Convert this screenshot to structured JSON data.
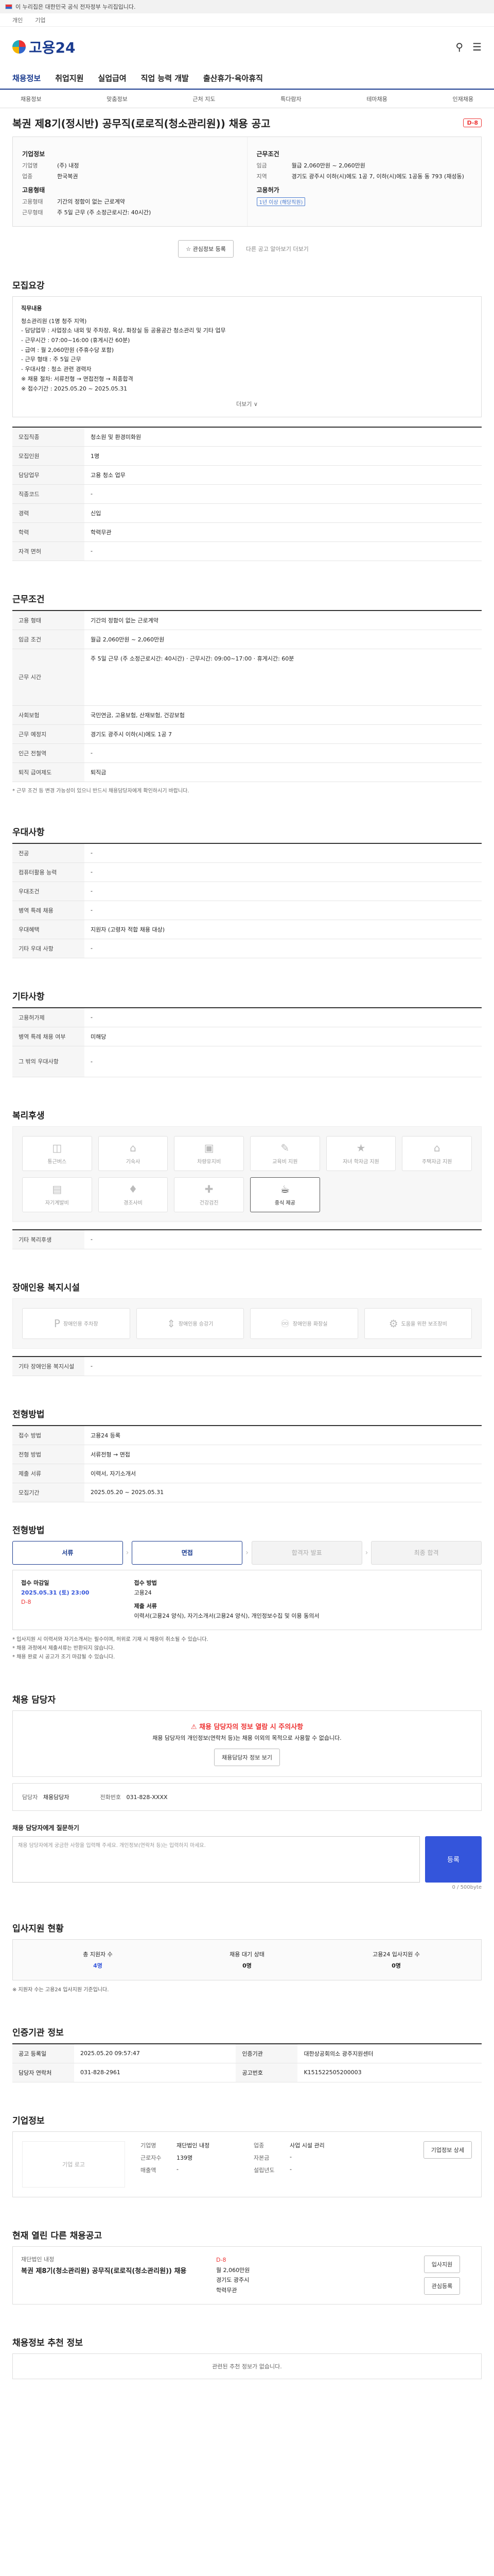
{
  "gov_banner": "이 누리집은 대한민국 공식 전자정부 누리집입니다.",
  "lang_bar": [
    "개인",
    "기업"
  ],
  "header": {
    "logo_text": "고용24",
    "search_icon": "search-icon",
    "menu_icon": "menu-icon"
  },
  "nav": {
    "items": [
      "채용정보",
      "취업지원",
      "실업급여",
      "직업 능력 개발",
      "출산휴가·육아휴직"
    ]
  },
  "subnav": {
    "items": [
      "채용정보",
      "맞춤정보",
      "근처 지도",
      "특다람자",
      "테마채용",
      "인재채용"
    ]
  },
  "job": {
    "title": "복권 제8기(정시반) 공무직(로로직(청소관리원)) 채용 공고",
    "dday": "D-8",
    "company_label": "기업정보",
    "company": "(주) 내정",
    "company_sub": "한국복권",
    "conditions_label": "근무조건",
    "pay_label": "임금",
    "pay": "월급 2,060만원 ~ 2,060만원",
    "place_label": "지역",
    "place": "경기도 광주시 이하(시)에도 1공 7, 이하(시)에도 1공동 동 793 (재성동)",
    "employment_label": "고용형태",
    "employment": "기간의 정함이 없는 근로계약",
    "work_type_label": "근무형태",
    "work_type": "주 5일 근무 (주 소정근로시간: 40시간)",
    "edu_label": "학력",
    "edu": "학력무관",
    "career_label": "경력",
    "career": "신입",
    "etc_label": "우대사항",
    "etc_tag": "고령자 적합",
    "req_label": "고용허가",
    "req": "1년 이상 (해당직원)"
  },
  "actions": {
    "scrap": "관심정보 등록",
    "share": "다른 공고 알아보기 더보기"
  },
  "sections": {
    "recruit": "모집요강",
    "work": "근무조건",
    "pref": "우대사항",
    "extra": "기타사항",
    "welfare": "복리후생",
    "disability": "장애인용 복지시설",
    "process": "전형방법",
    "contact": "채용 담당자",
    "apply_status": "입사지원 현황",
    "manage": "인증기관 정보",
    "company": "기업정보",
    "related": "현재 열린 다른 채용공고",
    "other": "채용정보 추천 정보"
  },
  "recruit_box": {
    "head": "직무내용",
    "lines": [
      "청소관리원 (1명 청주 지역)",
      "- 담당업무 : 사업장소 내외 및 주차장, 옥상, 화장실 등 공용공간 청소관리 및 기타 업무",
      "- 근무시간 : 07:00~16:00 (휴게시간 60분)",
      "- 급여 : 월 2,060만원 (주휴수당 포함)",
      "- 근무 형태 : 주 5일 근무",
      "- 우대사항 : 청소 관련 경력자",
      "※ 채용 절차: 서류전형 → 면접전형 → 최종합격",
      "※ 접수기간 : 2025.05.20 ~ 2025.05.31"
    ],
    "more": "더보기 ∨"
  },
  "recruit_table": [
    {
      "k": "모집직종",
      "v": "청소원 및 환경미화원"
    },
    {
      "k": "모집인원",
      "v": "1명"
    },
    {
      "k": "담당업무",
      "v": "고용 청소 업무"
    },
    {
      "k": "직종코드",
      "v": "-"
    },
    {
      "k": "경력",
      "v": "신입"
    },
    {
      "k": "학력",
      "v": "학력무관"
    },
    {
      "k": "자격 면허",
      "v": "-"
    }
  ],
  "work_table": [
    {
      "k": "고용 형태",
      "v": "기간의 정함이 없는 근로계약"
    },
    {
      "k": "임금 조건",
      "v": "월급 2,060만원 ~ 2,060만원"
    },
    {
      "k": "근무 시간",
      "v": "주 5일 근무 (주 소정근로시간: 40시간) · 근무시간: 09:00~17:00 · 휴게시간: 60분"
    },
    {
      "k": "사회보험",
      "v": "국민연금, 고용보험, 산재보험, 건강보험"
    },
    {
      "k": "근무 예정지",
      "v": "경기도 광주시 이하(시)에도 1공 7"
    },
    {
      "k": "인근 전철역",
      "v": "-"
    },
    {
      "k": "퇴직 급여제도",
      "v": "퇴직금"
    }
  ],
  "work_note": "* 근무 조건 등 변경 가능성이 있으니 반드시 채용담당자에게 확인하시기 바랍니다.",
  "pref_table": [
    {
      "k": "전공",
      "v": "-"
    },
    {
      "k": "컴퓨터활용 능력",
      "v": "-"
    },
    {
      "k": "우대조건",
      "v": "-"
    },
    {
      "k": "병역 특례 채용",
      "v": "-"
    },
    {
      "k": "우대혜택",
      "v": "지원자 (고령자 적합 채용 대상)"
    },
    {
      "k": "기타 우대 사항",
      "v": "-"
    }
  ],
  "extra_table": [
    {
      "k": "고용허가제",
      "v": "-"
    },
    {
      "k": "병역 특례 채용 여부",
      "v": "미해당"
    },
    {
      "k": "그 밖의 우대사항",
      "v": "-"
    }
  ],
  "welfare": [
    {
      "label": "통근버스",
      "icon": "bus-icon",
      "on": false
    },
    {
      "label": "기숙사",
      "icon": "dorm-icon",
      "on": false
    },
    {
      "label": "차량유지비",
      "icon": "car-icon",
      "on": false
    },
    {
      "label": "교육비 지원",
      "icon": "education-icon",
      "on": false
    },
    {
      "label": "자녀 학자금 지원",
      "icon": "scholarship-icon",
      "on": false
    },
    {
      "label": "주택자금 지원",
      "icon": "house-icon",
      "on": false
    },
    {
      "label": "자기계발비",
      "icon": "book-icon",
      "on": false
    },
    {
      "label": "경조사비",
      "icon": "gift-icon",
      "on": false
    },
    {
      "label": "건강검진",
      "icon": "health-icon",
      "on": false
    },
    {
      "label": "중식 제공",
      "icon": "meal-icon",
      "on": true
    }
  ],
  "welfare_note": "기타 복리후생",
  "disability": [
    {
      "label": "장애인용 주차장",
      "icon": "parking-icon"
    },
    {
      "label": "장애인용 승강기",
      "icon": "elevator-icon"
    },
    {
      "label": "장애인용 화장실",
      "icon": "toilet-icon"
    },
    {
      "label": "도움을 위한 보조장비",
      "icon": "assist-icon"
    }
  ],
  "disability_note": "기타 장애인용 복지시설",
  "process_table": [
    {
      "k": "접수 방법",
      "v": "고용24 등록"
    },
    {
      "k": "전형 방법",
      "v": "서류전형 → 면접"
    },
    {
      "k": "제출 서류",
      "v": "이력서, 자기소개서"
    },
    {
      "k": "모집기간",
      "v": "2025.05.20 ~ 2025.05.31"
    }
  ],
  "process_steps": [
    "서류",
    "면접",
    "합격자 발표",
    "최종 합격"
  ],
  "apply": {
    "deadline_label": "접수 마감일",
    "deadline": "2025.05.31 (토) 23:00",
    "dday": "D-8",
    "method_label": "접수 방법",
    "method": "고용24",
    "docs_label": "제출 서류",
    "docs": "이력서(고용24 양식), 자기소개서(고용24 양식), 개인정보수집 및 이용 동의서"
  },
  "apply_notes": [
    "* 입사지원 시 이력서와 자기소개서는 필수이며, 허위로 기재 시 채용이 취소될 수 있습니다.",
    "* 채용 과정에서 제출서류는 반환되지 않습니다.",
    "* 채용 완료 시 공고가 조기 마감될 수 있습니다."
  ],
  "alert": {
    "title": "채용 담당자의 정보 열람 시 주의사항",
    "text": "채용 담당자의 개인정보(연락처 등)는 채용 이외의 목적으로 사용할 수 없습니다.",
    "button": "채용담당자 정보 보기"
  },
  "contact_info": {
    "name_label": "담당자",
    "name": "채용담당자",
    "phone_label": "전화번호",
    "phone": "031-828-XXXX"
  },
  "question": {
    "label": "채용 담당자에게 질문하기",
    "placeholder": "채용 담당자에게 궁금한 사항을 입력해 주세요. 개인정보(연락처 등)는 입력하지 마세요.",
    "counter": "0 / 500byte",
    "button": "등록"
  },
  "stats": [
    {
      "label": "총 지원자 수",
      "value": "4명"
    },
    {
      "label": "채용 대기 상태",
      "value": "0명"
    },
    {
      "label": "고용24 입사지원 수",
      "value": "0명"
    }
  ],
  "stats_note": "※ 지원자 수는 고용24 입사지원 기준입니다.",
  "manage_table": [
    {
      "k": "공고 등록일",
      "v": "2025.05.20 09:57:47"
    },
    {
      "k": "인증기관",
      "v": "대한상공회의소 광주지원센터"
    },
    {
      "k": "담당자 연락처",
      "v": "031-828-2961"
    },
    {
      "k": "공고번호",
      "v": "K151522505200003"
    }
  ],
  "company": {
    "logo": "기업 로고",
    "name_k": "기업명",
    "name": "재단법인 내정",
    "type_k": "업종",
    "type": "사업 시설 관리",
    "emp_k": "근로자수",
    "emp": "139명",
    "cap_k": "자본금",
    "cap": "-",
    "sales_k": "매출액",
    "sales": "-",
    "est_k": "설립년도",
    "est": "-",
    "button": "기업정보 상세"
  },
  "related": {
    "company": "재단법인 내정",
    "title": "복권 제8기(청소관리원) 공무직(로로직(청소관리원)) 채용",
    "dday": "D-8",
    "pay": "월 2,060만원",
    "place": "경기도 광주시",
    "edu": "학력무관",
    "btn1": "입사지원",
    "btn2": "관심등록"
  },
  "footer": {
    "text": "관련된 추천 정보가 없습니다."
  }
}
